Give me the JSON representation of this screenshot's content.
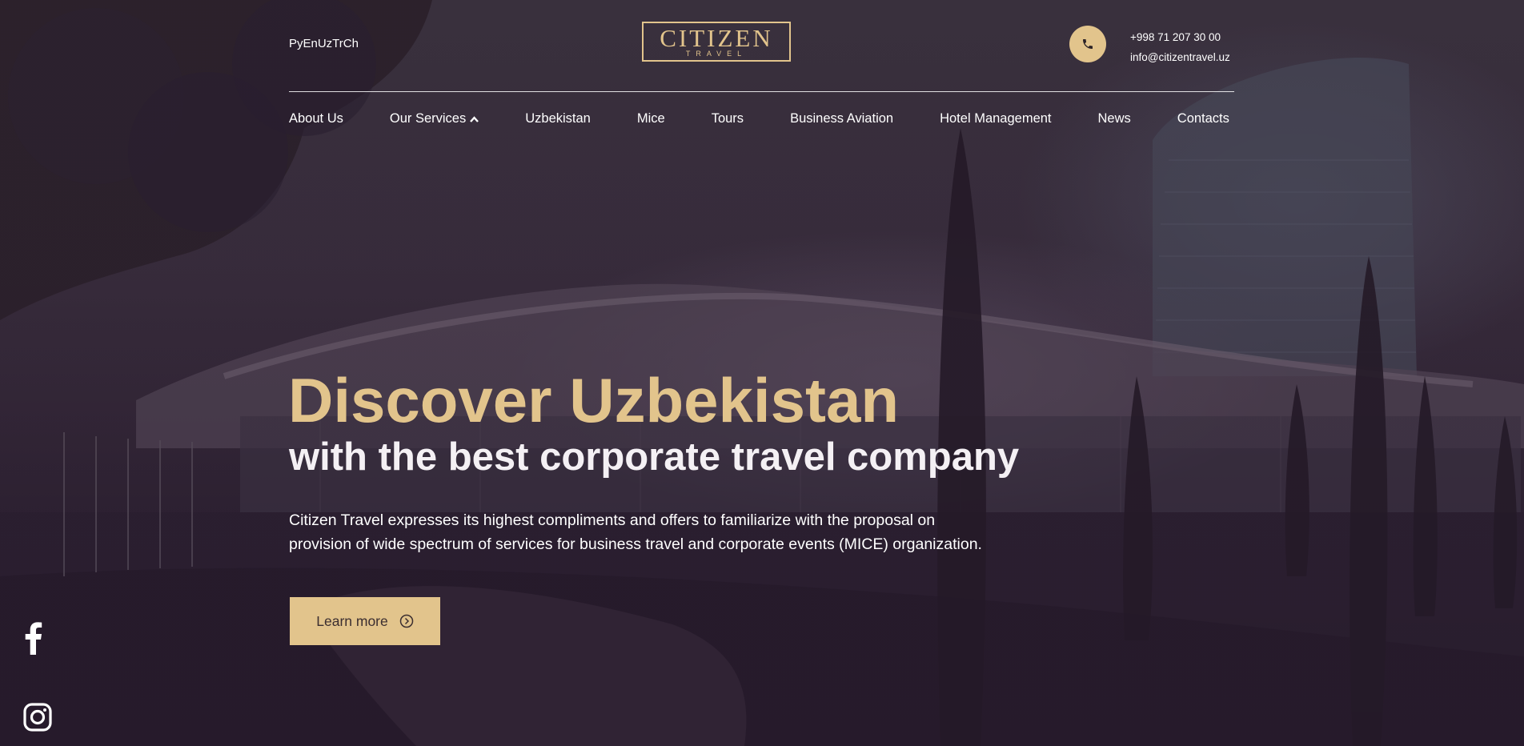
{
  "header": {
    "languages": "PyEnUzTrCh",
    "logo_main": "CITIZEN",
    "logo_sub": "TRAVEL",
    "phone": "+998 71 207 30 00",
    "email": "info@citizentravel.uz"
  },
  "nav": {
    "items": [
      {
        "label": "About Us"
      },
      {
        "label": "Our Services"
      },
      {
        "label": "Uzbekistan"
      },
      {
        "label": "Mice"
      },
      {
        "label": "Tours"
      },
      {
        "label": "Business Aviation"
      },
      {
        "label": "Hotel Management"
      },
      {
        "label": "News"
      },
      {
        "label": "Contacts"
      }
    ]
  },
  "hero": {
    "headline": "Discover Uzbekistan",
    "subheadline": "with the best corporate travel company",
    "description_line1": "Citizen Travel expresses its highest compliments and offers to familiarize with the proposal on",
    "description_line2": "provision of wide spectrum of services for business travel and corporate events (MICE) organization.",
    "cta_label": "Learn more"
  },
  "icons": {
    "phone": "phone-icon",
    "services_caret": "chevron-up-icon",
    "cta": "arrow-circle-right-icon",
    "facebook": "facebook-icon",
    "instagram": "instagram-icon"
  },
  "colors": {
    "accent": "#e2c48c",
    "text_light": "#ffffff",
    "cta_text": "#3b2e30"
  }
}
